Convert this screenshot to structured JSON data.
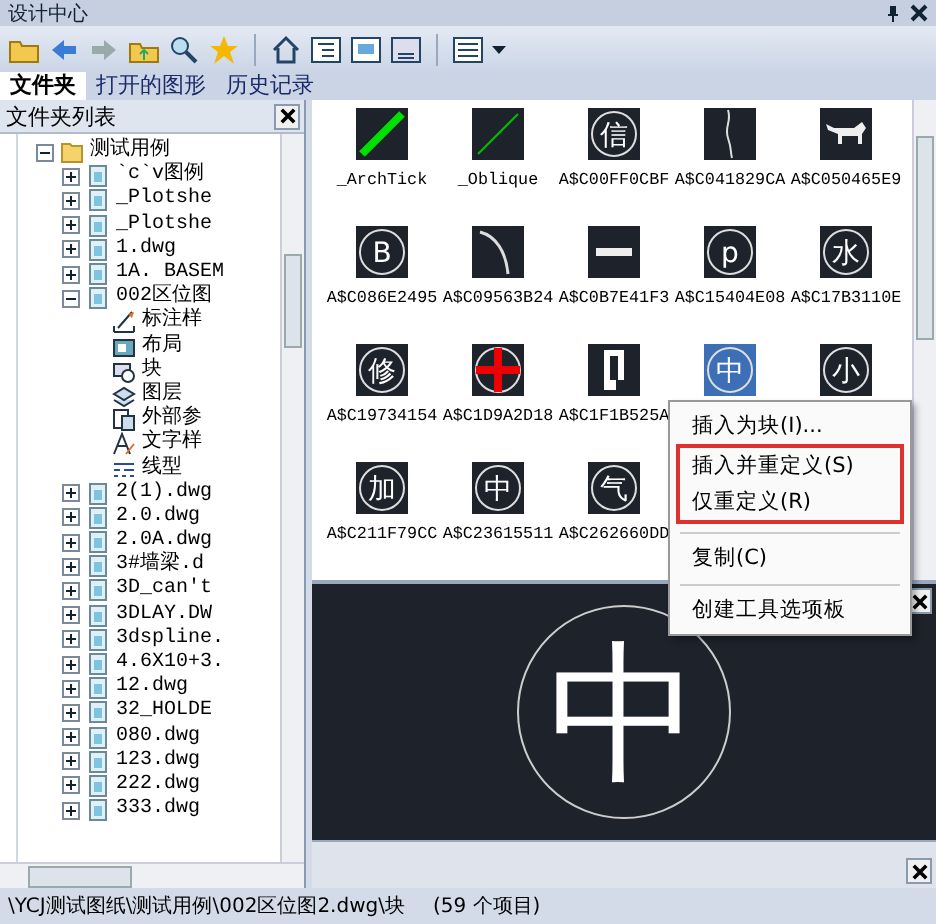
{
  "window": {
    "title": "设计中心"
  },
  "tabs": [
    {
      "label": "文件夹",
      "selected": true
    },
    {
      "label": "打开的图形",
      "selected": false
    },
    {
      "label": "历史记录",
      "selected": false
    }
  ],
  "folder_panel": {
    "title": "文件夹列表"
  },
  "tree": [
    {
      "label": "测试用例",
      "kind": "folder",
      "expanded": true,
      "children": [
        {
          "label": "`c`v图例",
          "kind": "drawing",
          "expanded": false
        },
        {
          "label": "_Plotshe",
          "kind": "drawing",
          "expanded": false
        },
        {
          "label": "_Plotshe",
          "kind": "drawing",
          "expanded": false
        },
        {
          "label": "1.dwg",
          "kind": "drawing",
          "expanded": false
        },
        {
          "label": "1A. BASEM",
          "kind": "drawing",
          "expanded": false
        },
        {
          "label": "002区位图",
          "kind": "drawing",
          "expanded": true,
          "children": [
            {
              "label": "标注样",
              "kind": "dimstyle"
            },
            {
              "label": "布局",
              "kind": "layout"
            },
            {
              "label": "块",
              "kind": "block"
            },
            {
              "label": "图层",
              "kind": "layer"
            },
            {
              "label": "外部参",
              "kind": "xref"
            },
            {
              "label": "文字样",
              "kind": "textstyle"
            },
            {
              "label": "线型",
              "kind": "linetype"
            }
          ]
        },
        {
          "label": "2(1).dwg",
          "kind": "drawing",
          "expanded": false
        },
        {
          "label": "2.0.dwg",
          "kind": "drawing",
          "expanded": false
        },
        {
          "label": "2.0A.dwg",
          "kind": "drawing",
          "expanded": false
        },
        {
          "label": "3#墙梁.d",
          "kind": "drawing",
          "expanded": false
        },
        {
          "label": "3D_can't",
          "kind": "drawing",
          "expanded": false
        },
        {
          "label": "3DLAY.DW",
          "kind": "drawing",
          "expanded": false
        },
        {
          "label": "3dspline.",
          "kind": "drawing",
          "expanded": false
        },
        {
          "label": "4.6X10+3.",
          "kind": "drawing",
          "expanded": false
        },
        {
          "label": "12.dwg",
          "kind": "drawing",
          "expanded": false
        },
        {
          "label": "32_HOLDE",
          "kind": "drawing",
          "expanded": false
        },
        {
          "label": "080.dwg",
          "kind": "drawing",
          "expanded": false
        },
        {
          "label": "123.dwg",
          "kind": "drawing",
          "expanded": false
        },
        {
          "label": "222.dwg",
          "kind": "drawing",
          "expanded": false
        },
        {
          "label": "333.dwg",
          "kind": "drawing",
          "expanded": false
        }
      ]
    }
  ],
  "blocks": [
    {
      "kind": "archtick",
      "label": "_ArchTick",
      "selected": false
    },
    {
      "kind": "oblique",
      "label": "_Oblique",
      "selected": false
    },
    {
      "kind": "glyph",
      "glyph": "信",
      "label": "A$C00FF0CBF",
      "selected": false
    },
    {
      "kind": "curve",
      "label": "A$C041829CA",
      "selected": false
    },
    {
      "kind": "figure",
      "label": "A$C050465E9",
      "selected": false
    },
    {
      "kind": "glyph",
      "glyph": "B",
      "label": "A$C086E2495",
      "selected": false
    },
    {
      "kind": "arc",
      "label": "A$C09563B24",
      "selected": false
    },
    {
      "kind": "textbar",
      "label": "A$C0B7E41F3",
      "selected": false
    },
    {
      "kind": "glyph",
      "glyph": "p",
      "label": "A$C15404E08",
      "selected": false
    },
    {
      "kind": "glyph",
      "glyph": "水",
      "label": "A$C17B3110E",
      "selected": false
    },
    {
      "kind": "glyph",
      "glyph": "修",
      "label": "A$C19734154",
      "selected": false
    },
    {
      "kind": "cross",
      "label": "A$C1D9A2D18",
      "selected": false
    },
    {
      "kind": "bracket",
      "label": "A$C1F1B525A",
      "selected": false
    },
    {
      "kind": "glyph",
      "glyph": "中",
      "selected": true
    },
    {
      "kind": "glyph",
      "glyph": "小",
      "selected": false
    },
    {
      "kind": "glyph",
      "glyph": "加",
      "label": "A$C211F79CC",
      "selected": false
    },
    {
      "kind": "glyph",
      "glyph": "中",
      "label": "A$C23615511",
      "selected": false
    },
    {
      "kind": "glyph",
      "glyph": "气",
      "label": "A$C262660DD",
      "selected": false
    }
  ],
  "context_menu": [
    {
      "label": "插入为块(I)...",
      "outlined": false,
      "separator_before": false
    },
    {
      "label": "插入并重定义(S)",
      "outlined": true,
      "separator_before": false
    },
    {
      "label": "仅重定义(R)",
      "outlined": true,
      "separator_before": false
    },
    {
      "label": "复制(C)",
      "outlined": false,
      "separator_before": true
    },
    {
      "label": "创建工具选项板",
      "outlined": false,
      "separator_before": true
    }
  ],
  "preview": {
    "glyph": "中"
  },
  "status_bar": {
    "path": "\\YCJ测试图纸\\测试用例\\002区位图2.dwg\\块",
    "count": "(59 个项目)"
  }
}
